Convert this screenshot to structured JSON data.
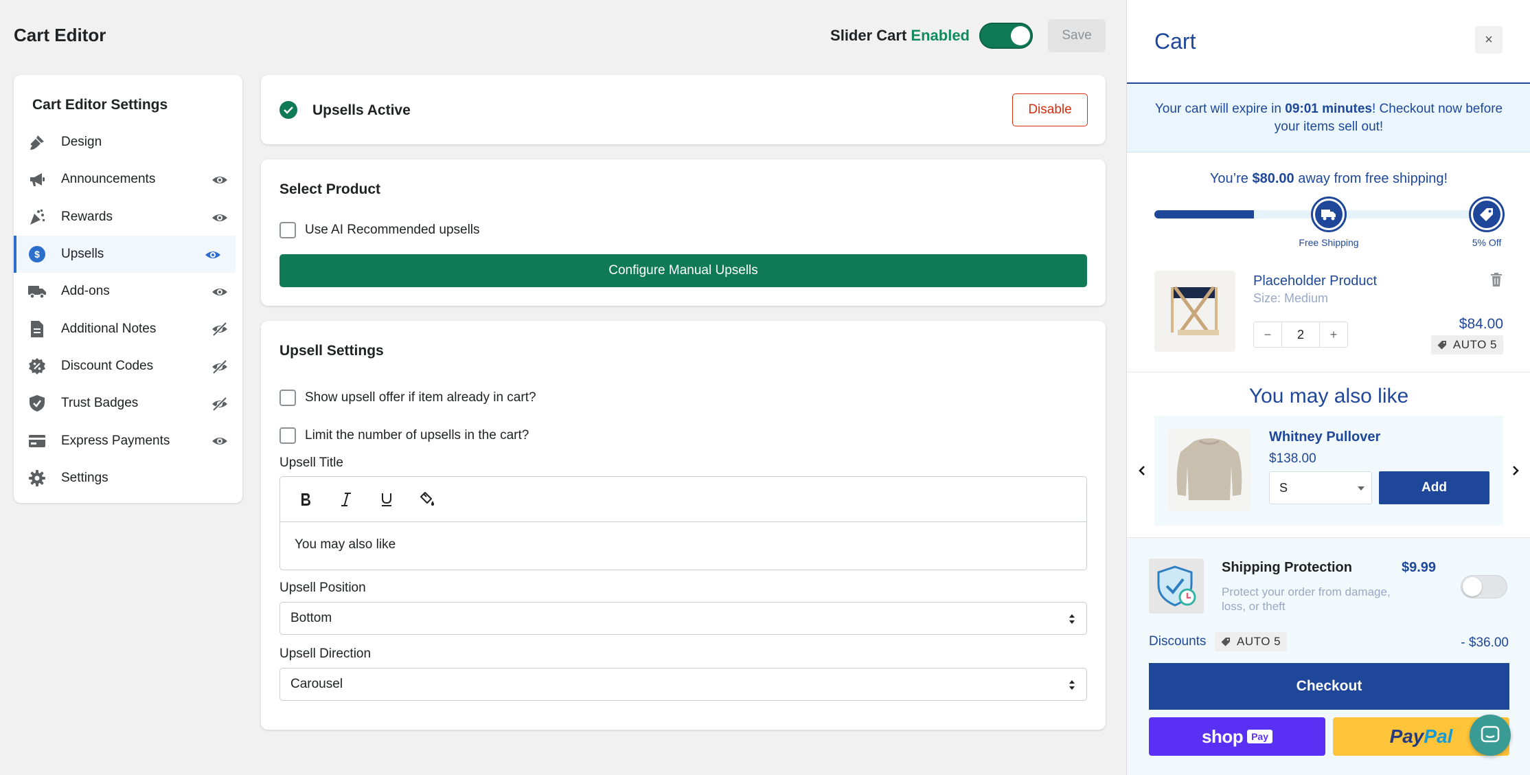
{
  "editor": {
    "title": "Cart Editor",
    "slider_cart_label": "Slider Cart",
    "slider_cart_status": "Enabled",
    "save_label": "Save"
  },
  "sidebar": {
    "title": "Cart Editor Settings",
    "items": [
      {
        "label": "Design",
        "icon": "paintbrush-icon",
        "visibility": "none"
      },
      {
        "label": "Announcements",
        "icon": "megaphone-icon",
        "visibility": "visible"
      },
      {
        "label": "Rewards",
        "icon": "confetti-icon",
        "visibility": "visible"
      },
      {
        "label": "Upsells",
        "icon": "dollar-circle-icon",
        "visibility": "visible"
      },
      {
        "label": "Add-ons",
        "icon": "truck-icon",
        "visibility": "visible"
      },
      {
        "label": "Additional Notes",
        "icon": "document-icon",
        "visibility": "hidden"
      },
      {
        "label": "Discount Codes",
        "icon": "discount-badge-icon",
        "visibility": "hidden"
      },
      {
        "label": "Trust Badges",
        "icon": "shield-check-icon",
        "visibility": "hidden"
      },
      {
        "label": "Express Payments",
        "icon": "credit-card-icon",
        "visibility": "visible"
      },
      {
        "label": "Settings",
        "icon": "gear-icon",
        "visibility": "none"
      }
    ]
  },
  "upsells_active": {
    "title": "Upsells Active",
    "disable_label": "Disable"
  },
  "select_product": {
    "title": "Select Product",
    "ai_checkbox_label": "Use AI Recommended upsells",
    "configure_label": "Configure Manual Upsells"
  },
  "upsell_settings": {
    "title": "Upsell Settings",
    "show_if_in_cart_label": "Show upsell offer if item already in cart?",
    "limit_label": "Limit the number of upsells in the cart?",
    "upsell_title_label": "Upsell Title",
    "upsell_title_value": "You may also like",
    "position_label": "Upsell Position",
    "position_value": "Bottom",
    "direction_label": "Upsell Direction",
    "direction_value": "Carousel"
  },
  "cart": {
    "title": "Cart",
    "close_glyph": "×",
    "timer_pre": "Your cart will expire in ",
    "timer_time": "09:01 minutes",
    "timer_post": "! Checkout now before your items sell out!",
    "shipping_pre": "You’re ",
    "shipping_amount": "$80.00",
    "shipping_post": " away from free shipping!",
    "progress_fraction": 0.29,
    "milestones": [
      {
        "label": "Free Shipping",
        "icon": "truck-icon"
      },
      {
        "label": "5% Off",
        "icon": "tag-icon"
      }
    ],
    "line_item": {
      "name": "Placeholder Product",
      "size": "Size: Medium",
      "quantity": "2",
      "minus": "−",
      "plus": "+",
      "price": "$84.00",
      "discount_tag": "AUTO 5"
    },
    "upsell": {
      "title": "You may also like",
      "name": "Whitney Pullover",
      "price": "$138.00",
      "size_value": "S",
      "add_label": "Add"
    },
    "shipping_protection": {
      "title": "Shipping Protection",
      "price": "$9.99",
      "description": "Protect your order from damage, loss, or theft"
    },
    "discounts_label": "Discounts",
    "discount_tag": "AUTO 5",
    "discount_amount": "- $36.00",
    "checkout_label": "Checkout",
    "shoppay_text": "shop",
    "shoppay_badge": "Pay",
    "paypal_text_1": "Pay",
    "paypal_text_2": "Pal"
  },
  "colors": {
    "accent_green": "#0f7a55",
    "cart_blue": "#1e4799",
    "danger_red": "#d72c0d"
  }
}
